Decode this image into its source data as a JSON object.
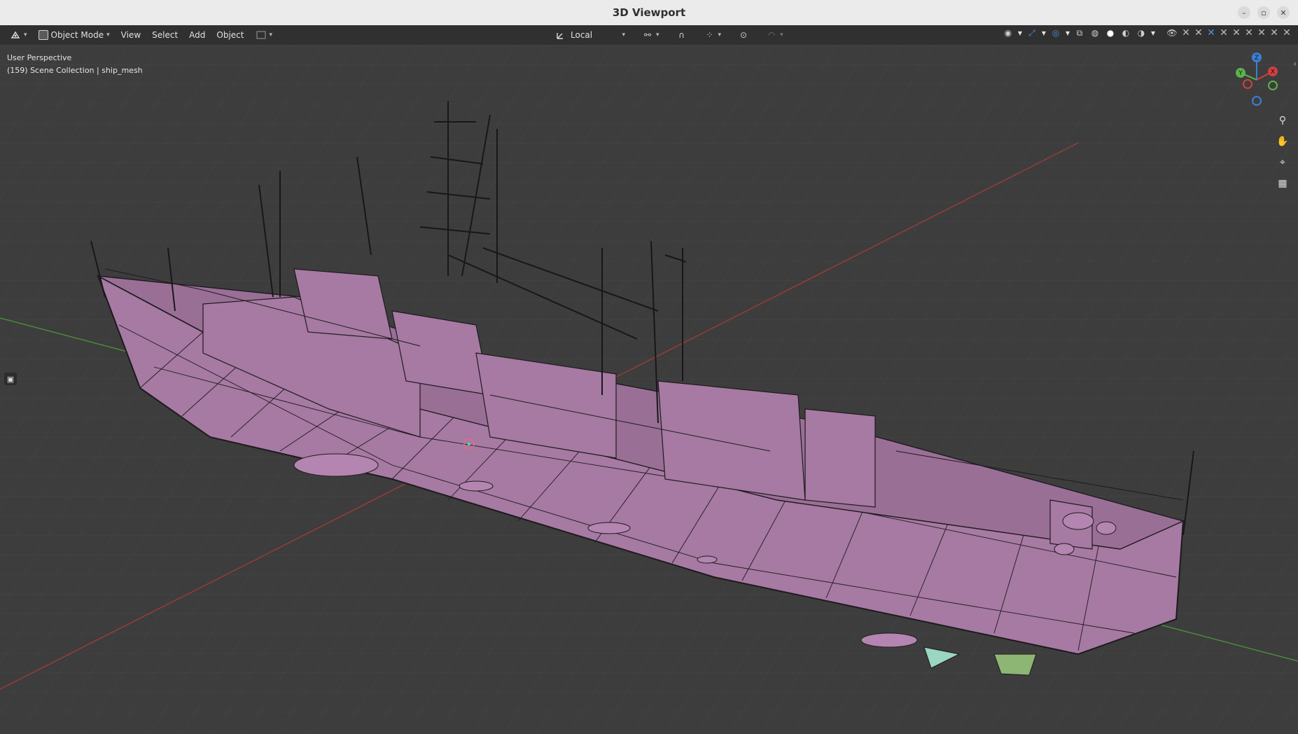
{
  "window": {
    "title": "3D Viewport"
  },
  "header": {
    "mode_label": "Object Mode",
    "menu": [
      "View",
      "Select",
      "Add",
      "Object"
    ],
    "transform_orientation": "Local"
  },
  "viewport": {
    "perspective_label": "User Perspective",
    "collection_label": "(159) Scene Collection | ship_mesh",
    "gizmo_axes": {
      "x": "X",
      "y": "Y",
      "z": "Z"
    }
  },
  "colors": {
    "mesh_fill": "#a67aa2",
    "mesh_wire": "#1e1a1e",
    "grid_line": "#474747",
    "x_axis": "#a03a3a",
    "y_axis": "#4f8f3c",
    "header_bg": "#303030",
    "titlebar_bg": "#ebebeb",
    "accent_blue": "#4e8fe8"
  },
  "icons": {
    "editor_type": "editor-type-icon",
    "mode": "object-mode-icon",
    "orientation": "transform-orientation-icon",
    "pivot": "pivot-point-icon",
    "snap": "snap-icon",
    "proportional": "proportional-edit-icon",
    "visibility": "visibility-icon",
    "gizmo_toggle": "gizmo-toggle-icon",
    "overlay": "overlay-icon",
    "xray": "xray-icon",
    "shading_wire": "wireframe-shading-icon",
    "shading_solid": "solid-shading-icon",
    "shading_material": "material-shading-icon",
    "shading_rendered": "rendered-shading-icon",
    "zoom": "zoom-icon",
    "pan": "hand-pan-icon",
    "camera": "camera-view-icon",
    "ortho": "ortho-grid-icon"
  }
}
